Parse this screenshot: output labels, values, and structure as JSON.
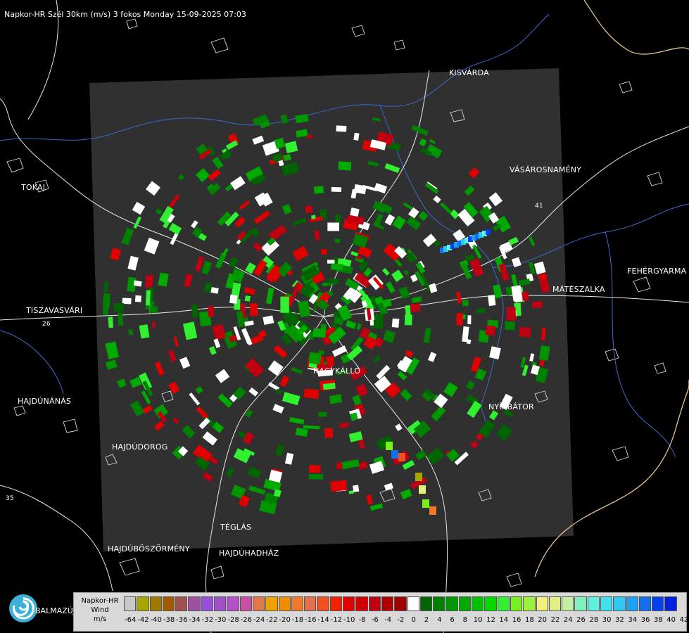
{
  "title": "Napkor-HR Szél 30km (m/s) 3 fokos Monday 15-09-2025 07:03",
  "cities": [
    {
      "name": "KISVÁRDA"
    },
    {
      "name": "TOKAJ"
    },
    {
      "name": "VÁSÁROSNAMÉNY"
    },
    {
      "name": "FEHÉRGYARMA"
    },
    {
      "name": "MÁTÉSZALKA"
    },
    {
      "name": "TISZAVASVÁRI"
    },
    {
      "name": "NAGYKÁLLÓ"
    },
    {
      "name": "NYÍRBÁTOR"
    },
    {
      "name": "HAJDÚNÁNÁS"
    },
    {
      "name": "HAJDÚDOROG"
    },
    {
      "name": "TÉGLÁS"
    },
    {
      "name": "HAJDÚBÖSZÖRMÉNY"
    },
    {
      "name": "HAJDÚHADHÁZ"
    },
    {
      "name": "BALMAZÚJVÁROS"
    }
  ],
  "road_labels": [
    "26",
    "41",
    "35"
  ],
  "legend": {
    "line1": "Napkor-HR",
    "line2": "Wind",
    "line3": "m/s",
    "ticks": [
      "-64",
      "-42",
      "-40",
      "-38",
      "-36",
      "-34",
      "-32",
      "-30",
      "-28",
      "-26",
      "-24",
      "-22",
      "-20",
      "-18",
      "-16",
      "-14",
      "-12",
      "-10",
      "-8",
      "-6",
      "-4",
      "-2",
      "0",
      "2",
      "4",
      "6",
      "8",
      "10",
      "12",
      "14",
      "16",
      "18",
      "20",
      "22",
      "24",
      "26",
      "28",
      "30",
      "32",
      "34",
      "36",
      "38",
      "40",
      "42"
    ],
    "colors": [
      "#c8c8c8",
      "#a6a600",
      "#a07800",
      "#a05a00",
      "#a05050",
      "#a050a0",
      "#9a4ee0",
      "#a050c8",
      "#b450c8",
      "#c850a0",
      "#e0784a",
      "#f0a000",
      "#f08c00",
      "#f07a28",
      "#e07050",
      "#f05020",
      "#f02000",
      "#e00000",
      "#d00000",
      "#c00010",
      "#b00000",
      "#a00000",
      "#ffffff",
      "#006400",
      "#008000",
      "#009600",
      "#00aa00",
      "#00c000",
      "#00d800",
      "#30f030",
      "#78f020",
      "#a0f040",
      "#f0f080",
      "#e0f080",
      "#c0f0a0",
      "#80f0c0",
      "#60f0e0",
      "#40e0f0",
      "#30c8f0",
      "#20a0f0",
      "#1070f0",
      "#0040f0",
      "#0020e0"
    ],
    "accent_background": "#303030"
  },
  "logo": {
    "icon": "spiral-logo-icon"
  }
}
